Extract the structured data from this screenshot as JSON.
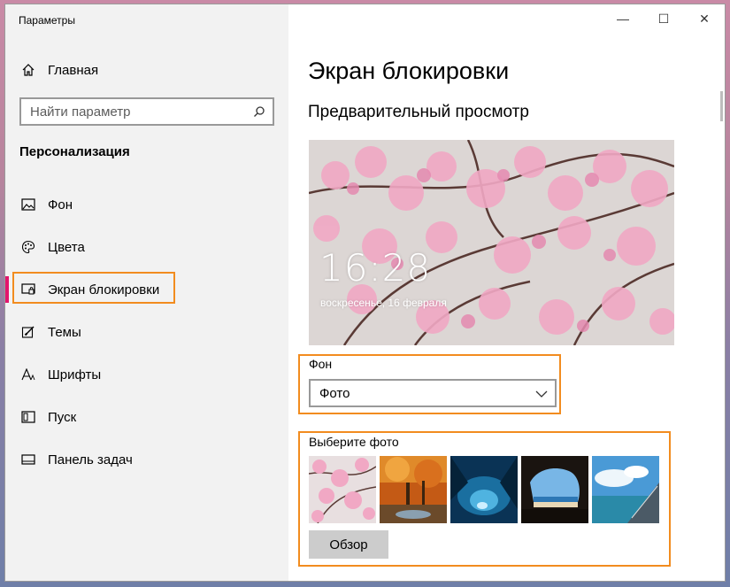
{
  "window": {
    "title": "Параметры",
    "controls": {
      "minimize": "—",
      "maximize": "☐",
      "close": "✕"
    }
  },
  "sidebar": {
    "home": {
      "label": "Главная",
      "icon": "home-icon"
    },
    "search": {
      "placeholder": "Найти параметр",
      "icon": "search-icon"
    },
    "section": "Персонализация",
    "items": [
      {
        "id": "background",
        "label": "Фон",
        "icon": "image-icon"
      },
      {
        "id": "colors",
        "label": "Цвета",
        "icon": "palette-icon"
      },
      {
        "id": "lockscreen",
        "label": "Экран блокировки",
        "icon": "lock-screen-icon",
        "active": true
      },
      {
        "id": "themes",
        "label": "Темы",
        "icon": "brush-icon"
      },
      {
        "id": "fonts",
        "label": "Шрифты",
        "icon": "font-icon"
      },
      {
        "id": "start",
        "label": "Пуск",
        "icon": "start-icon"
      },
      {
        "id": "taskbar",
        "label": "Панель задач",
        "icon": "taskbar-icon"
      }
    ]
  },
  "main": {
    "title": "Экран блокировки",
    "preview_heading": "Предварительный просмотр",
    "preview": {
      "time": "16:28",
      "date": "воскресенье, 16 февраля"
    },
    "background": {
      "label": "Фон",
      "selected": "Фото"
    },
    "choose_photo": {
      "label": "Выберите фото",
      "browse": "Обзор"
    }
  },
  "colors": {
    "highlight": "#f28c1f",
    "accent": "#e3156d"
  }
}
